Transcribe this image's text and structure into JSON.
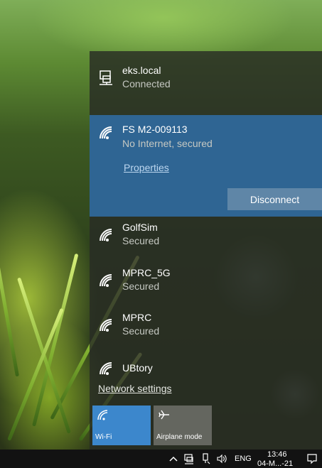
{
  "networks": {
    "connected": {
      "name": "eks.local",
      "status": "Connected",
      "icon": "ethernet-icon"
    },
    "selected": {
      "name": "FS M2-009113",
      "status": "No Internet, secured",
      "icon": "wifi-signal-icon",
      "properties_label": "Properties",
      "disconnect_label": "Disconnect"
    },
    "available": [
      {
        "name": "GolfSim",
        "status": "Secured",
        "icon": "wifi-signal-icon"
      },
      {
        "name": "MPRC_5G",
        "status": "Secured",
        "icon": "wifi-signal-icon"
      },
      {
        "name": "MPRC",
        "status": "Secured",
        "icon": "wifi-signal-icon"
      },
      {
        "name": "UBtory",
        "status": "",
        "icon": "wifi-signal-icon"
      }
    ]
  },
  "network_settings_label": "Network settings",
  "quick_actions": [
    {
      "label": "Wi-Fi",
      "icon": "wifi-icon",
      "active": true
    },
    {
      "label": "Airplane mode",
      "icon": "airplane-icon",
      "active": false
    }
  ],
  "taskbar": {
    "language": "ENG",
    "time": "13:46",
    "date": "04-M...-21",
    "icons": [
      "chevron-up-icon",
      "network-icon",
      "usb-icon",
      "volume-icon",
      "notification-icon"
    ]
  },
  "colors": {
    "selected_bg": "#2f6593",
    "wifi_tile_bg": "#3c87cc",
    "disconnect_bg": "#5f86a7"
  }
}
